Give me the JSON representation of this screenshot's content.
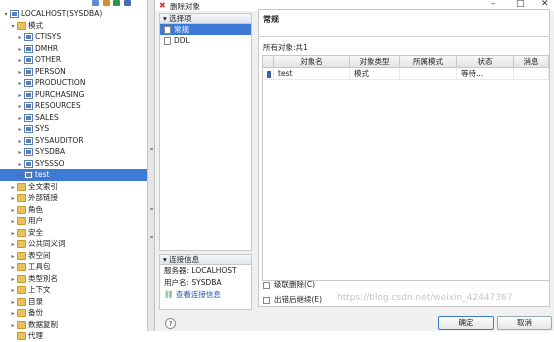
{
  "tree": {
    "root": "LOCALHOST(SYSDBA)",
    "schema_folder": "模式",
    "schemas": [
      "CTISYS",
      "DMHR",
      "OTHER",
      "PERSON",
      "PRODUCTION",
      "PURCHASING",
      "RESOURCES",
      "SALES",
      "SYS",
      "SYSAUDITOR",
      "SYSDBA",
      "SYSSSO",
      "test"
    ],
    "selected_schema": "test",
    "folders": [
      "全文索引",
      "外部链接",
      "角色",
      "用户",
      "安全",
      "公共同义词",
      "表空间",
      "工具包",
      "类型別名",
      "上下文",
      "目录",
      "备份",
      "数据复制"
    ],
    "last_item": "代理"
  },
  "dialog": {
    "title": "删除对象",
    "options_header": "选择项",
    "options": [
      "常规",
      "DDL"
    ],
    "connection_header": "连接信息",
    "server_label": "服务器: LOCALHOST",
    "user_label": "用户名: SYSDBA",
    "view_link": "查看连接信息",
    "main_title": "常规",
    "count_label": "所有对象:共1",
    "columns": [
      "对象名",
      "对象类型",
      "所属模式",
      "状态",
      "消息"
    ],
    "rows": [
      {
        "name": "test",
        "type": "模式",
        "schema": "",
        "status": "等待...",
        "message": ""
      }
    ],
    "cascade_label": "级联删除(C)",
    "stop_label": "出错后继续(E)",
    "help": "?",
    "ok": "确定",
    "cancel": "取消"
  },
  "watermark": "https://blog.csdn.net/weixin_42447367",
  "colors": {
    "selection": "#3d7ad6",
    "folder": "#e8c25a",
    "close": "#d33333"
  }
}
